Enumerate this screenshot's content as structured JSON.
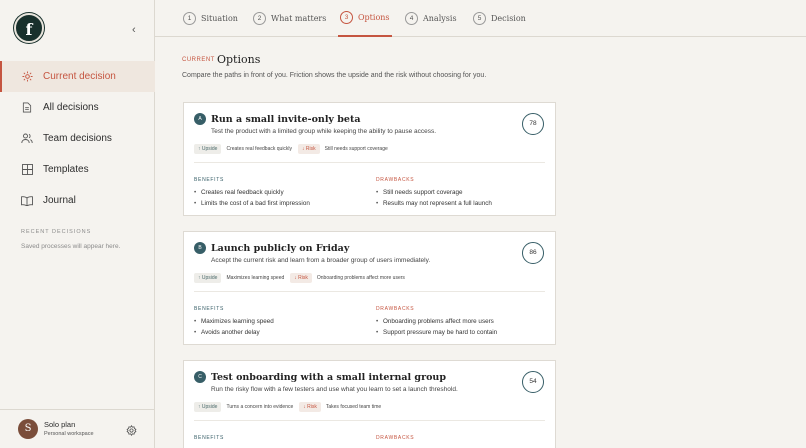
{
  "logo": "f",
  "sidebar": {
    "collapse_icon": "‹",
    "items": [
      {
        "label": "Current decision",
        "icon": "sun-icon"
      },
      {
        "label": "All decisions",
        "icon": "document-icon"
      },
      {
        "label": "Team decisions",
        "icon": "users-icon"
      },
      {
        "label": "Templates",
        "icon": "grid-icon"
      },
      {
        "label": "Journal",
        "icon": "book-icon"
      }
    ],
    "recent_title": "RECENT DECISIONS",
    "recent_empty": "Saved processes will appear here.",
    "user": {
      "initial": "S",
      "plan": "Solo plan",
      "workspace": "Personal workspace"
    }
  },
  "steps": [
    {
      "num": "1",
      "label": "Situation"
    },
    {
      "num": "2",
      "label": "What matters"
    },
    {
      "num": "3",
      "label": "Options"
    },
    {
      "num": "4",
      "label": "Analysis"
    },
    {
      "num": "5",
      "label": "Decision"
    }
  ],
  "page": {
    "crumb": "CURRENT",
    "title": "Options",
    "description": "Compare the paths in front of you. Friction shows the upside and the risk without choosing for you."
  },
  "labels": {
    "benefits": "BENEFITS",
    "drawbacks": "DRAWBACKS",
    "upside": "↑ Upside",
    "risk": "↓ Risk"
  },
  "options": [
    {
      "badge": "A",
      "title": "Run a small invite-only beta",
      "subtitle": "Test the product with a limited group while keeping the ability to pause access.",
      "score": "78",
      "upside": "Creates real feedback quickly",
      "risk": "Still needs support coverage",
      "benefits": [
        "Creates real feedback quickly",
        "Limits the cost of a bad first impression"
      ],
      "drawbacks": [
        "Still needs support coverage",
        "Results may not represent a full launch"
      ]
    },
    {
      "badge": "B",
      "title": "Launch publicly on Friday",
      "subtitle": "Accept the current risk and learn from a broader group of users immediately.",
      "score": "86",
      "upside": "Maximizes learning speed",
      "risk": "Onboarding problems affect more users",
      "benefits": [
        "Maximizes learning speed",
        "Avoids another delay"
      ],
      "drawbacks": [
        "Onboarding problems affect more users",
        "Support pressure may be hard to contain"
      ]
    },
    {
      "badge": "C",
      "title": "Test onboarding with a small internal group",
      "subtitle": "Run the risky flow with a few testers and use what you learn to set a launch threshold.",
      "score": "54",
      "upside": "Turns a concern into evidence",
      "risk": "Takes focused team time",
      "benefits": [],
      "drawbacks": []
    }
  ]
}
